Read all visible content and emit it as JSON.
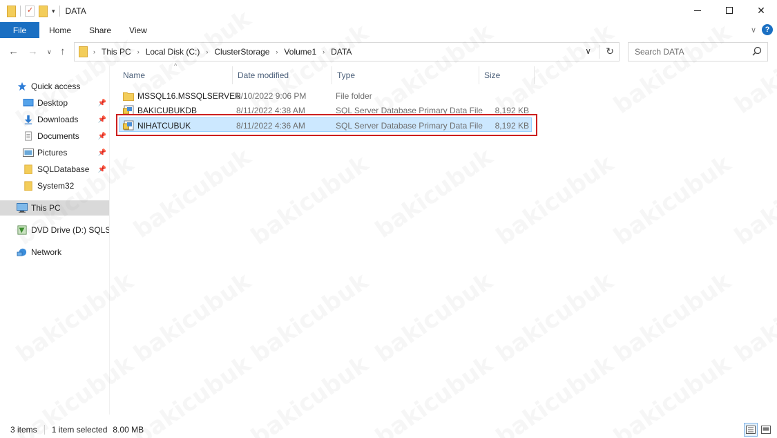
{
  "window": {
    "title": "DATA"
  },
  "ribbon": {
    "tabs": [
      "File",
      "Home",
      "Share",
      "View"
    ]
  },
  "address": {
    "crumbs": [
      "This PC",
      "Local Disk (C:)",
      "ClusterStorage",
      "Volume1",
      "DATA"
    ]
  },
  "search": {
    "placeholder": "Search DATA"
  },
  "sidebar": {
    "items": [
      {
        "label": "Quick access",
        "icon": "star-icon",
        "pinned": false
      },
      {
        "label": "Desktop",
        "icon": "desktop-icon",
        "pinned": true
      },
      {
        "label": "Downloads",
        "icon": "download-arrow-icon",
        "pinned": true
      },
      {
        "label": "Documents",
        "icon": "document-icon",
        "pinned": true
      },
      {
        "label": "Pictures",
        "icon": "pictures-icon",
        "pinned": true
      },
      {
        "label": "SQLDatabase",
        "icon": "folder-icon",
        "pinned": true
      },
      {
        "label": "System32",
        "icon": "folder-icon",
        "pinned": false
      },
      {
        "label": "This PC",
        "icon": "computer-icon",
        "pinned": false,
        "selected": true
      },
      {
        "label": "DVD Drive (D:) SQLSe",
        "icon": "dvd-drive-icon",
        "pinned": false
      },
      {
        "label": "Network",
        "icon": "network-icon",
        "pinned": false
      }
    ]
  },
  "columns": {
    "name": "Name",
    "date": "Date modified",
    "type": "Type",
    "size": "Size"
  },
  "files": [
    {
      "name": "MSSQL16.MSSQLSERVER",
      "date": "8/10/2022 9:06 PM",
      "type": "File folder",
      "size": "",
      "icon": "folder-icon"
    },
    {
      "name": "BAKICUBUKDB",
      "date": "8/11/2022 4:38 AM",
      "type": "SQL Server Database Primary Data File",
      "size": "8,192 KB",
      "icon": "sql-data-file-icon"
    },
    {
      "name": "NIHATCUBUK",
      "date": "8/11/2022 4:36 AM",
      "type": "SQL Server Database Primary Data File",
      "size": "8,192 KB",
      "icon": "sql-data-file-icon",
      "selected": true
    }
  ],
  "status": {
    "items": "3 items",
    "selected": "1 item selected",
    "size": "8.00 MB"
  },
  "watermark": "bakicubuk"
}
